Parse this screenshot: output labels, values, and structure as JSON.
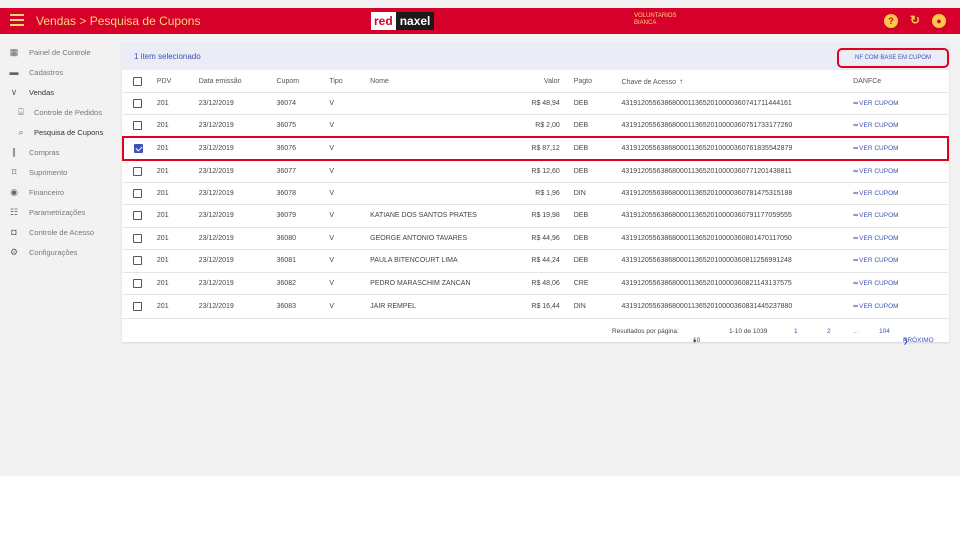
{
  "topbar": {
    "title": "Vendas > Pesquisa de Cupons",
    "logo_left": "red",
    "logo_right": "naxel",
    "user_line1": "VOLUNTARIOS",
    "user_line2": "BIANCA",
    "colors": {
      "bar": "#d6002a",
      "title_text": "#f7d774"
    }
  },
  "sidebar": {
    "items": [
      {
        "label": "Painel de Controle",
        "icon": "dashboard-icon"
      },
      {
        "label": "Cadastros",
        "icon": "folder-icon"
      },
      {
        "label": "Vendas",
        "icon": "chevron-down-icon"
      },
      {
        "label": "Controle de Pedidos",
        "icon": "register-icon"
      },
      {
        "label": "Pesquisa de Cupons",
        "icon": "zoom-icon"
      },
      {
        "label": "Compras",
        "icon": "barcode-icon"
      },
      {
        "label": "Suprimento",
        "icon": "crop-icon"
      },
      {
        "label": "Financeiro",
        "icon": "coin-icon"
      },
      {
        "label": "Parametrizações",
        "icon": "sliders-icon"
      },
      {
        "label": "Controle de Acesso",
        "icon": "shield-icon"
      },
      {
        "label": "Configurações",
        "icon": "gear-icon"
      }
    ]
  },
  "selection": {
    "text": "1 item selecionado",
    "nf_button": "NF COM BASE EM CUPOM"
  },
  "table": {
    "headers": {
      "pdv": "PDV",
      "data": "Data emissão",
      "cupom": "Cupom",
      "tipo": "Tipo",
      "nome": "Nome",
      "valor": "Valor",
      "pagto": "Pagto",
      "chave": "Chave de Acesso",
      "danfe": "DANFCe"
    },
    "ver_label": "VER CUPOM",
    "rows": [
      {
        "pdv": "201",
        "data": "23/12/2019",
        "cupom": "36074",
        "tipo": "V",
        "nome": "",
        "valor": "R$ 48,94",
        "pagto": "DEB",
        "chave": "43191205563868000113652010000360741711444161"
      },
      {
        "pdv": "201",
        "data": "23/12/2019",
        "cupom": "36075",
        "tipo": "V",
        "nome": "",
        "valor": "R$ 2,00",
        "pagto": "DEB",
        "chave": "43191205563868000113652010000360751733177260"
      },
      {
        "pdv": "201",
        "data": "23/12/2019",
        "cupom": "36076",
        "tipo": "V",
        "nome": "",
        "valor": "R$ 87,12",
        "pagto": "DEB",
        "chave": "43191205563868000113652010000360761835542879"
      },
      {
        "pdv": "201",
        "data": "23/12/2019",
        "cupom": "36077",
        "tipo": "V",
        "nome": "",
        "valor": "R$ 12,60",
        "pagto": "DEB",
        "chave": "43191205563868000113652010000360771201438811"
      },
      {
        "pdv": "201",
        "data": "23/12/2019",
        "cupom": "36078",
        "tipo": "V",
        "nome": "",
        "valor": "R$ 1,96",
        "pagto": "DIN",
        "chave": "43191205563868000113652010000360781475315188"
      },
      {
        "pdv": "201",
        "data": "23/12/2019",
        "cupom": "36079",
        "tipo": "V",
        "nome": "KATIANE DOS SANTOS PRATES",
        "valor": "R$ 19,98",
        "pagto": "DEB",
        "chave": "43191205563868000113652010000360791177059555"
      },
      {
        "pdv": "201",
        "data": "23/12/2019",
        "cupom": "36080",
        "tipo": "V",
        "nome": "GEORGE ANTONIO TAVARES",
        "valor": "R$ 44,96",
        "pagto": "DEB",
        "chave": "43191205563868000113652010000360801470117050"
      },
      {
        "pdv": "201",
        "data": "23/12/2019",
        "cupom": "36081",
        "tipo": "V",
        "nome": "PAULA BITENCOURT LIMA",
        "valor": "R$ 44,24",
        "pagto": "DEB",
        "chave": "43191205563868000113652010000360811256991248"
      },
      {
        "pdv": "201",
        "data": "23/12/2019",
        "cupom": "36082",
        "tipo": "V",
        "nome": "PEDRO MARASCHIM ZANCAN",
        "valor": "R$ 48,06",
        "pagto": "CRE",
        "chave": "43191205563868000113652010000360821143137575"
      },
      {
        "pdv": "201",
        "data": "23/12/2019",
        "cupom": "36083",
        "tipo": "V",
        "nome": "JAIR REMPEL",
        "valor": "R$ 16,44",
        "pagto": "DIN",
        "chave": "43191205563868000113652010000360831445237880"
      }
    ]
  },
  "pager": {
    "per_page_label": "Resultados por página:",
    "per_page_value": "10",
    "range": "1-10 de 1039",
    "page1": "1",
    "page2": "2",
    "ellipsis": "...",
    "last": "104",
    "next": "PRÓXIMO"
  },
  "colors": {
    "accent": "#3f51b5",
    "highlight_border": "#e00020"
  }
}
